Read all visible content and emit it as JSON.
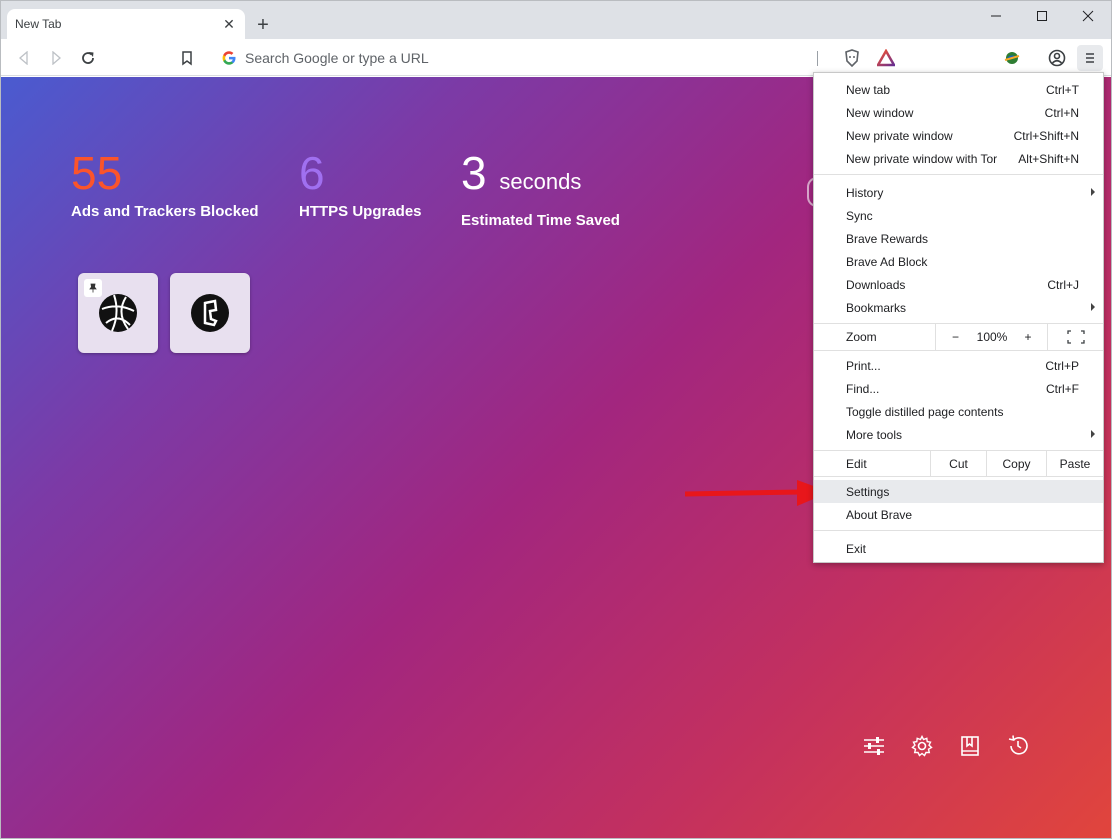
{
  "tab": {
    "title": "New Tab",
    "close": "✕",
    "new_tab": "+"
  },
  "window_controls": {
    "minimize": "—",
    "maximize": "☐",
    "close": "✕"
  },
  "omnibox": {
    "placeholder": "Search Google or type a URL"
  },
  "stats": [
    {
      "value": "55",
      "unit": "",
      "label": "Ads and Trackers Blocked",
      "color": "#fb542b"
    },
    {
      "value": "6",
      "unit": "",
      "label": "HTTPS Upgrades",
      "color": "#a0a5eb"
    },
    {
      "value": "3",
      "unit": "seconds",
      "label": "Estimated Time Saved",
      "color": "#ffffff"
    }
  ],
  "menu": {
    "new_tab": {
      "label": "New tab",
      "shortcut": "Ctrl+T"
    },
    "new_window": {
      "label": "New window",
      "shortcut": "Ctrl+N"
    },
    "new_private": {
      "label": "New private window",
      "shortcut": "Ctrl+Shift+N"
    },
    "new_private_tor": {
      "label": "New private window with Tor",
      "shortcut": "Alt+Shift+N"
    },
    "history": {
      "label": "History"
    },
    "sync": {
      "label": "Sync"
    },
    "rewards": {
      "label": "Brave Rewards"
    },
    "adblock": {
      "label": "Brave Ad Block"
    },
    "downloads": {
      "label": "Downloads",
      "shortcut": "Ctrl+J"
    },
    "bookmarks": {
      "label": "Bookmarks"
    },
    "zoom": {
      "label": "Zoom",
      "minus": "−",
      "value": "100%",
      "plus": "+"
    },
    "print": {
      "label": "Print...",
      "shortcut": "Ctrl+P"
    },
    "find": {
      "label": "Find...",
      "shortcut": "Ctrl+F"
    },
    "distill": {
      "label": "Toggle distilled page contents"
    },
    "more_tools": {
      "label": "More tools"
    },
    "edit": {
      "label": "Edit",
      "cut": "Cut",
      "copy": "Copy",
      "paste": "Paste"
    },
    "settings": {
      "label": "Settings"
    },
    "about": {
      "label": "About Brave"
    },
    "exit": {
      "label": "Exit"
    }
  },
  "colors": {
    "highlight": "#e8eaed",
    "arrow": "#e8161b"
  }
}
